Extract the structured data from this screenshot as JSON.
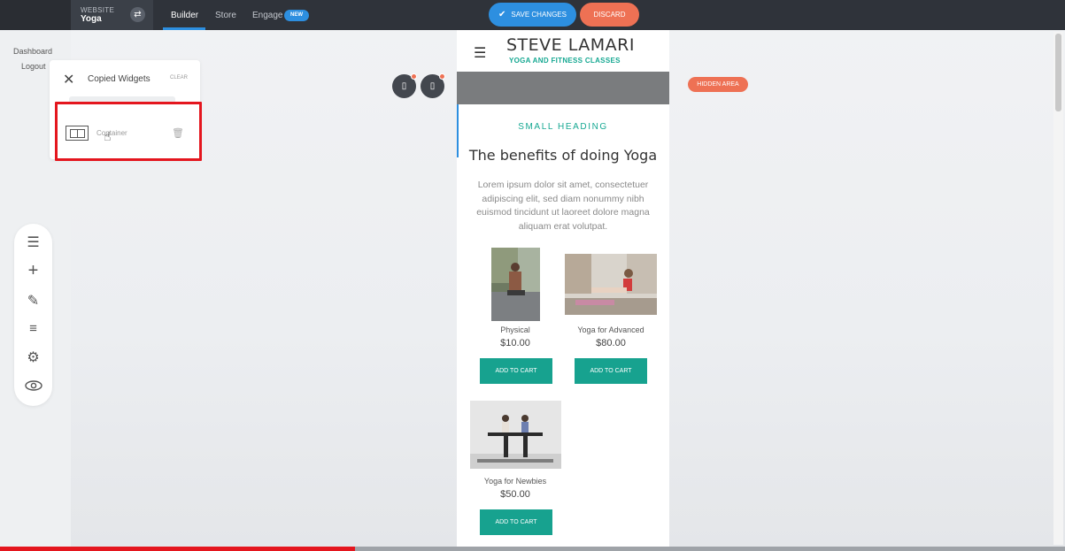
{
  "topbar": {
    "site_label": "WEBSITE",
    "site_name": "Yoga",
    "tabs": [
      {
        "label": "Builder"
      },
      {
        "label": "Store"
      },
      {
        "label": "Engage"
      }
    ],
    "new_badge": "NEW",
    "save_label": "SAVE CHANGES",
    "discard_label": "DISCARD"
  },
  "sidebar": {
    "links": [
      {
        "label": "Dashboard"
      },
      {
        "label": "Logout"
      }
    ]
  },
  "copied_widgets": {
    "title": "Copied Widgets",
    "clear_label": "CLEAR",
    "items": [
      {
        "label": "Container",
        "icon": "container-icon"
      }
    ]
  },
  "toolbar": {
    "icons": [
      "menu-icon",
      "plus-icon",
      "brush-icon",
      "filter-icon",
      "gear-icon",
      "eye-icon"
    ]
  },
  "preview": {
    "hidden_area_label": "HIDDEN AREA",
    "site_title": "STEVE LAMARI",
    "tagline": "YOGA AND FITNESS CLASSES",
    "small_heading": "SMALL HEADING",
    "heading": "The benefits of doing Yoga",
    "paragraph": "Lorem ipsum dolor sit amet, consectetuer adipiscing elit, sed diam nonummy nibh euismod tincidunt ut laoreet dolore magna aliquam erat volutpat.",
    "products": [
      {
        "name": "Physical",
        "price": "$10.00",
        "button": "ADD TO CART"
      },
      {
        "name": "Yoga for Advanced",
        "price": "$80.00",
        "button": "ADD TO CART"
      },
      {
        "name": "Yoga for Newbies",
        "price": "$50.00",
        "button": "ADD TO CART"
      }
    ]
  },
  "video_progress": 0.333,
  "colors": {
    "topbar": "#2f333a",
    "accent_blue": "#2d8fe0",
    "discard_orange": "#ee7154",
    "teal": "#17a28f",
    "highlight_red": "#e4161e"
  }
}
